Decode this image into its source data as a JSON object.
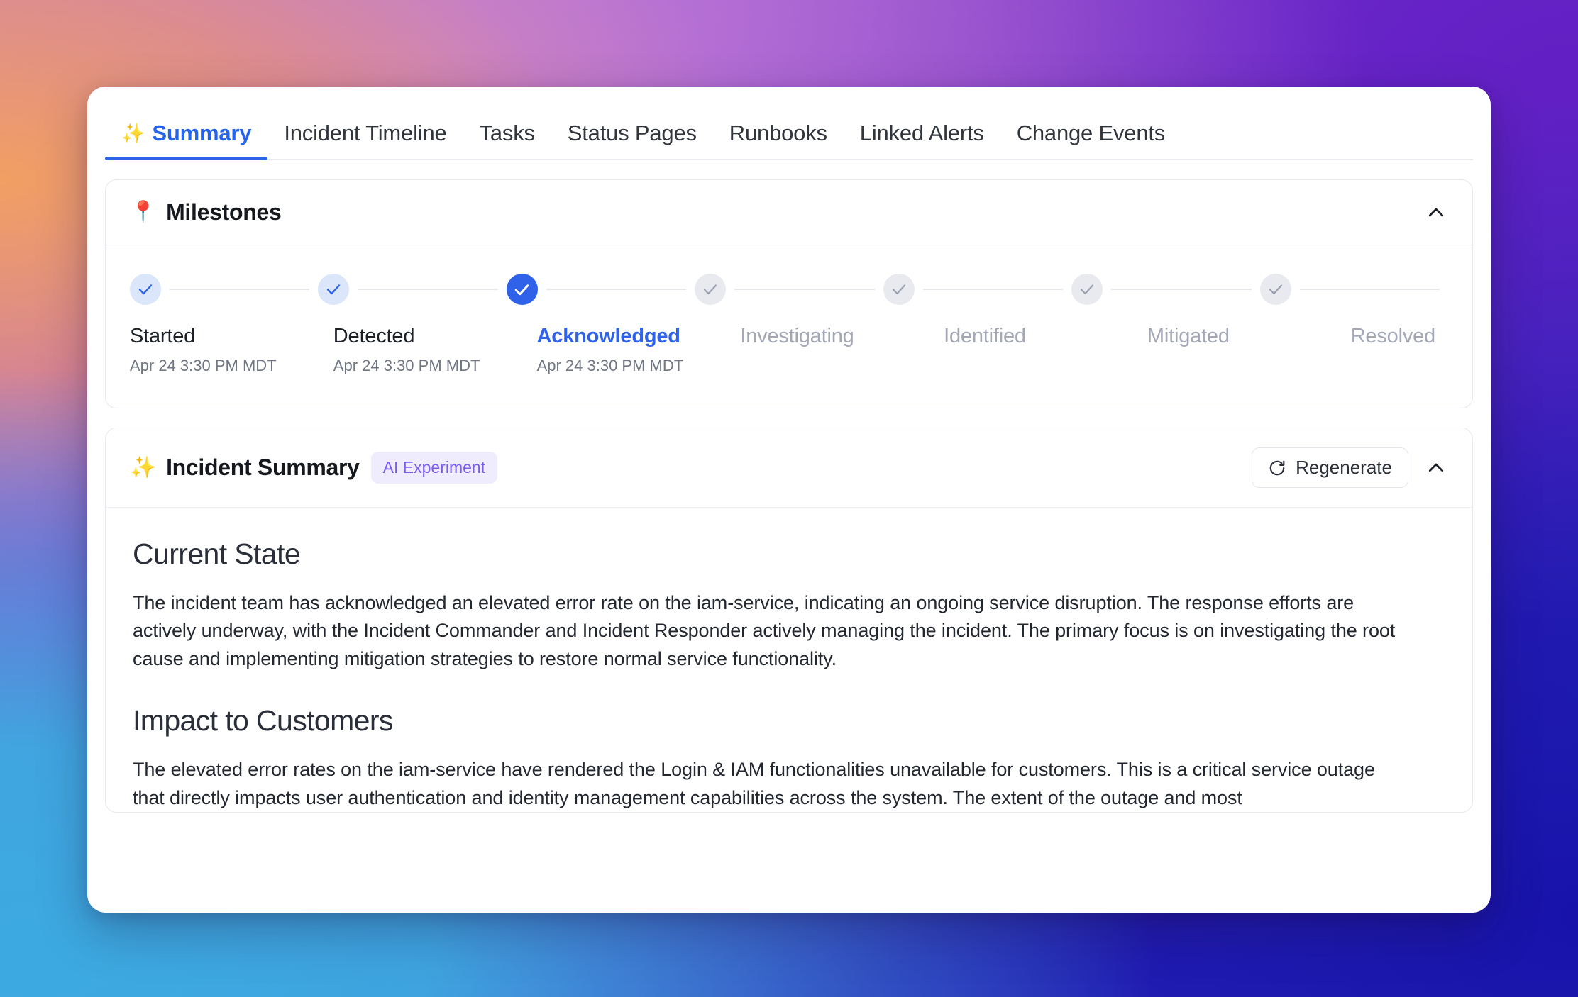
{
  "tabs": [
    {
      "label": "Summary",
      "icon": "✨",
      "active": true
    },
    {
      "label": "Incident Timeline",
      "icon": "",
      "active": false
    },
    {
      "label": "Tasks",
      "icon": "",
      "active": false
    },
    {
      "label": "Status Pages",
      "icon": "",
      "active": false
    },
    {
      "label": "Runbooks",
      "icon": "",
      "active": false
    },
    {
      "label": "Linked Alerts",
      "icon": "",
      "active": false
    },
    {
      "label": "Change Events",
      "icon": "",
      "active": false
    }
  ],
  "milestones_panel": {
    "emoji": "📍",
    "title": "Milestones",
    "collapse_icon": "chevron-up",
    "steps": [
      {
        "label": "Started",
        "time": "Apr 24 3:30 PM MDT",
        "state": "done"
      },
      {
        "label": "Detected",
        "time": "Apr 24 3:30 PM MDT",
        "state": "done"
      },
      {
        "label": "Acknowledged",
        "time": "Apr 24 3:30 PM MDT",
        "state": "current"
      },
      {
        "label": "Investigating",
        "time": "",
        "state": "todo"
      },
      {
        "label": "Identified",
        "time": "",
        "state": "todo"
      },
      {
        "label": "Mitigated",
        "time": "",
        "state": "todo"
      },
      {
        "label": "Resolved",
        "time": "",
        "state": "todo"
      }
    ]
  },
  "summary_panel": {
    "emoji": "✨",
    "title": "Incident Summary",
    "badge": "AI Experiment",
    "regenerate_label": "Regenerate",
    "collapse_icon": "chevron-up",
    "sections": [
      {
        "heading": "Current State",
        "body": "The incident team has acknowledged an elevated error rate on the iam-service, indicating an ongoing service disruption. The response efforts are actively underway, with the Incident Commander and Incident Responder actively managing the incident. The primary focus is on investigating the root cause and implementing mitigation strategies to restore normal service functionality."
      },
      {
        "heading": "Impact to Customers",
        "body": "The elevated error rates on the iam-service have rendered the Login & IAM functionalities unavailable for customers. This is a critical service outage that directly impacts user authentication and identity management capabilities across the system. The extent of the outage and most"
      }
    ]
  },
  "colors": {
    "accent_blue": "#2f62e8",
    "tab_active": "#2563eb",
    "badge_purple": "#7b5cf0",
    "badge_bg": "#eeecfd",
    "step_done_bg": "#dbe6fb",
    "step_todo_bg": "#e8eaef",
    "text_muted": "#a3a7b6"
  }
}
